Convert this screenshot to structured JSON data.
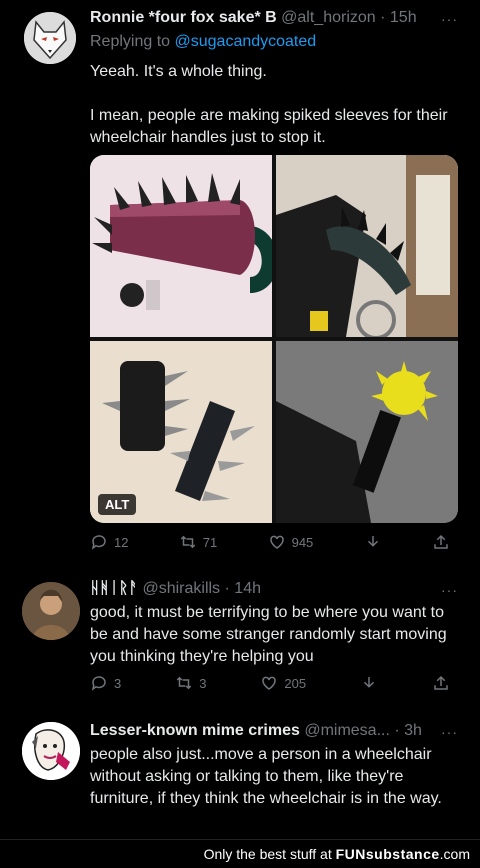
{
  "tweets": [
    {
      "name": "Ronnie *four fox sake* B",
      "handle": "@alt_horizon",
      "time": "· 15h",
      "reply_prefix": "Replying to ",
      "reply_handle": "@sugacandycoated",
      "lines": [
        "Yeeah. It's a whole thing.",
        "I mean, people are making spiked sleeves for their wheelchair handles just to stop it."
      ],
      "alt_label": "ALT",
      "replies": "12",
      "retweets": "71",
      "likes": "945"
    },
    {
      "name": "ᚺᚻᛁᚱᚨ",
      "handle": "@shirakills",
      "time": "· 14h",
      "text": "good, it must be terrifying to be where you want to be and have some stranger randomly start moving you thinking they're helping you",
      "replies": "3",
      "retweets": "3",
      "likes": "205"
    },
    {
      "name": "Lesser-known mime crimes",
      "handle": "@mimesa...",
      "time": "· 3h",
      "text": "people also just...move a person in a wheelchair without asking or talking to them, like they're furniture, if they think the wheelchair is in the way."
    }
  ],
  "more": "···",
  "footer": {
    "prefix": "Only the best stuff at ",
    "brand": "FUNsubstance",
    "suffix": ".com"
  },
  "icons": [
    "reply-icon",
    "retweet-icon",
    "like-icon",
    "share-icon"
  ],
  "colors": {
    "link": "#1d9bf0",
    "muted": "#71767b",
    "text": "#e7e9ea",
    "bg": "#000000"
  }
}
